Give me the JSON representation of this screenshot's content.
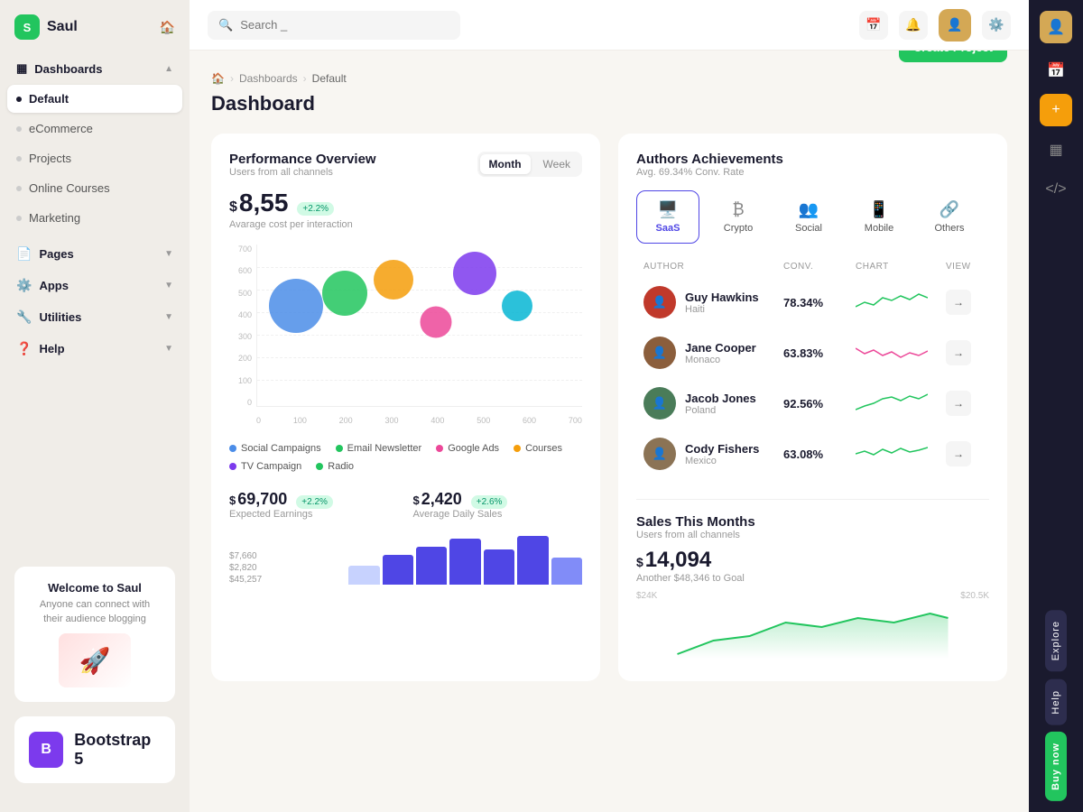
{
  "app": {
    "name": "Saul",
    "logo_letter": "S"
  },
  "topbar": {
    "search_placeholder": "Search _"
  },
  "breadcrumb": {
    "home": "🏠",
    "section": "Dashboards",
    "current": "Default"
  },
  "page": {
    "title": "Dashboard",
    "create_btn": "Create Project"
  },
  "sidebar": {
    "items": [
      {
        "label": "Dashboards",
        "type": "section",
        "has_chevron": true
      },
      {
        "label": "Default",
        "type": "child",
        "active": true
      },
      {
        "label": "eCommerce",
        "type": "child"
      },
      {
        "label": "Projects",
        "type": "child"
      },
      {
        "label": "Online Courses",
        "type": "child"
      },
      {
        "label": "Marketing",
        "type": "child"
      },
      {
        "label": "Pages",
        "type": "section",
        "has_chevron": true
      },
      {
        "label": "Apps",
        "type": "section",
        "has_chevron": true
      },
      {
        "label": "Utilities",
        "type": "section",
        "has_chevron": true
      },
      {
        "label": "Help",
        "type": "section",
        "has_chevron": true
      }
    ],
    "welcome": {
      "title": "Welcome to Saul",
      "subtitle": "Anyone can connect with their audience blogging"
    }
  },
  "performance": {
    "title": "Performance Overview",
    "subtitle": "Users from all channels",
    "toggle": {
      "month": "Month",
      "week": "Week",
      "active": "Month"
    },
    "cost": {
      "dollar": "$",
      "amount": "8,55",
      "badge": "+2.2%",
      "label": "Avarage cost per interaction"
    },
    "chart": {
      "y_labels": [
        "700",
        "600",
        "500",
        "400",
        "300",
        "200",
        "100",
        "0"
      ],
      "x_labels": [
        "0",
        "100",
        "200",
        "300",
        "400",
        "500",
        "600",
        "700"
      ],
      "bubbles": [
        {
          "x": 16,
          "y": 45,
          "size": 60,
          "color": "#4b8de8"
        },
        {
          "x": 28,
          "y": 37,
          "size": 50,
          "color": "#22c55e"
        },
        {
          "x": 39,
          "y": 30,
          "size": 44,
          "color": "#f59e0b"
        },
        {
          "x": 50,
          "y": 40,
          "size": 35,
          "color": "#ec4899"
        },
        {
          "x": 58,
          "y": 22,
          "size": 48,
          "color": "#7c3aed"
        },
        {
          "x": 68,
          "y": 37,
          "size": 34,
          "color": "#06b6d4"
        }
      ]
    },
    "legend": [
      {
        "label": "Social Campaigns",
        "color": "#4b8de8"
      },
      {
        "label": "Email Newsletter",
        "color": "#22c55e"
      },
      {
        "label": "Google Ads",
        "color": "#ec4899"
      },
      {
        "label": "Courses",
        "color": "#f59e0b"
      },
      {
        "label": "TV Campaign",
        "color": "#7c3aed"
      },
      {
        "label": "Radio",
        "color": "#22c55e"
      }
    ]
  },
  "authors": {
    "title": "Authors Achievements",
    "subtitle": "Avg. 69.34% Conv. Rate",
    "categories": [
      {
        "label": "SaaS",
        "icon": "🖥️",
        "active": true
      },
      {
        "label": "Crypto",
        "icon": "₿"
      },
      {
        "label": "Social",
        "icon": "👥"
      },
      {
        "label": "Mobile",
        "icon": "📱"
      },
      {
        "label": "Others",
        "icon": "🔗"
      }
    ],
    "table_headers": {
      "author": "AUTHOR",
      "conv": "CONV.",
      "chart": "CHART",
      "view": "VIEW"
    },
    "rows": [
      {
        "name": "Guy Hawkins",
        "location": "Haiti",
        "conv": "78.34%",
        "chart_color": "#22c55e",
        "avatar_bg": "#c0392b"
      },
      {
        "name": "Jane Cooper",
        "location": "Monaco",
        "conv": "63.83%",
        "chart_color": "#ec4899",
        "avatar_bg": "#8b5e3c"
      },
      {
        "name": "Jacob Jones",
        "location": "Poland",
        "conv": "92.56%",
        "chart_color": "#22c55e",
        "avatar_bg": "#4a7c59"
      },
      {
        "name": "Cody Fishers",
        "location": "Mexico",
        "conv": "63.08%",
        "chart_color": "#22c55e",
        "avatar_bg": "#8b7355"
      }
    ]
  },
  "stats": {
    "earnings": {
      "dollar": "$",
      "amount": "69,700",
      "badge": "+2.2%",
      "label": "Expected Earnings"
    },
    "daily": {
      "dollar": "$",
      "amount": "2,420",
      "badge": "+2.6%",
      "label": "Average Daily Sales"
    }
  },
  "sales": {
    "title": "Sales This Months",
    "subtitle": "Users from all channels",
    "amount_dollar": "$",
    "amount": "14,094",
    "note": "Another $48,346 to Goal",
    "y_labels": [
      "$24K",
      "$20.5K"
    ],
    "bars": [
      30,
      45,
      55,
      70,
      65,
      80,
      50
    ]
  },
  "right_panel": {
    "explore": "Explore",
    "help": "Help",
    "buy": "Buy now"
  }
}
